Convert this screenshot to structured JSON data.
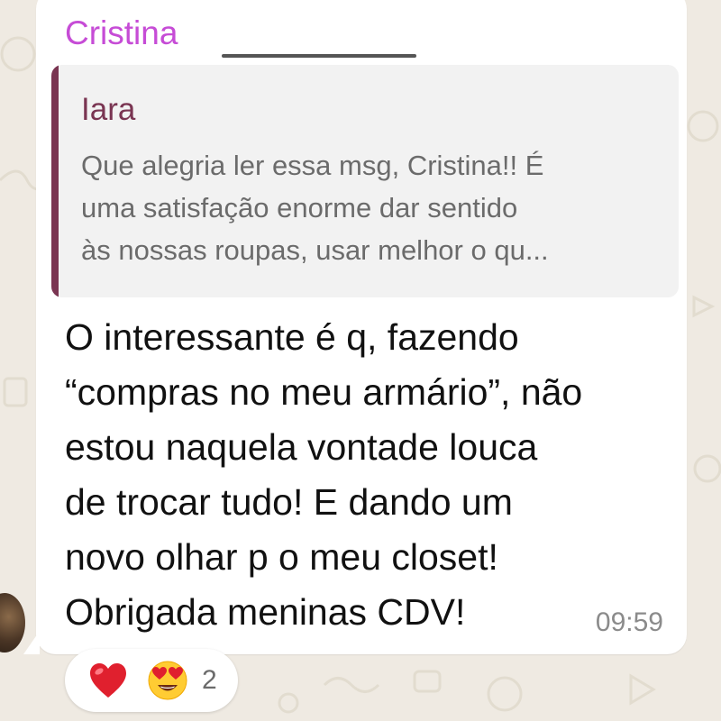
{
  "sender": {
    "name": "Cristina"
  },
  "quoted": {
    "author": "Iara",
    "lines": [
      "Que alegria ler essa msg, Cristina!! É",
      "uma satisfação enorme dar sentido",
      "às nossas roupas, usar melhor o qu..."
    ]
  },
  "message": {
    "lines": [
      "O interessante é q, fazendo",
      "“compras no meu armário”, não",
      "estou naquela vontade louca",
      "de trocar tudo! E dando um",
      "novo olhar p o meu closet!",
      "Obrigada meninas CDV!"
    ],
    "time": "09:59"
  },
  "reactions": {
    "items": [
      "heart-icon",
      "heart-eyes-face-icon"
    ],
    "count": "2"
  },
  "colors": {
    "sender": "#c64cd6",
    "quote_bar": "#7a3552",
    "bubble": "#ffffff",
    "background": "#efeae2"
  }
}
